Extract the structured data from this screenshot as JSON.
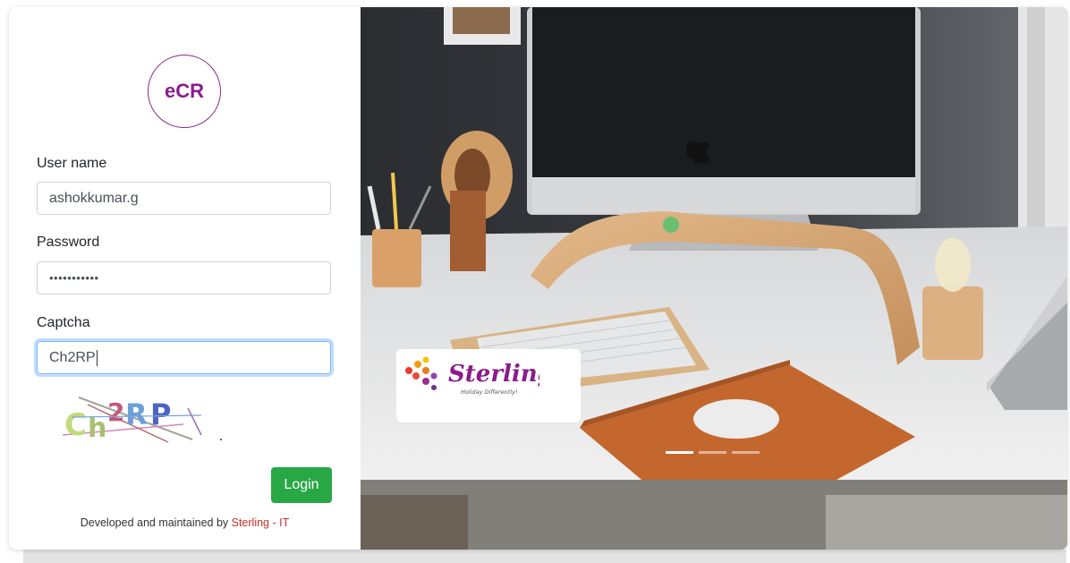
{
  "app": {
    "logo_text": "eCR"
  },
  "form": {
    "username_label": "User name",
    "username_value": "ashokkumar.g",
    "password_label": "Password",
    "password_value": "•••••••••••",
    "captcha_label": "Captcha",
    "captcha_value": "Ch2RP",
    "captcha_image_text": "Ch2RP",
    "login_label": "Login"
  },
  "footer": {
    "text": "Developed and maintained by ",
    "brand": "Sterling - IT"
  },
  "carousel": {
    "brand_name": "Sterling",
    "brand_tagline": "Holiday Differently!",
    "slide_count": 3,
    "active_slide": 1
  },
  "colors": {
    "accent": "#8b1c8b",
    "login_button": "#28a745",
    "brand_link": "#c9302c"
  }
}
